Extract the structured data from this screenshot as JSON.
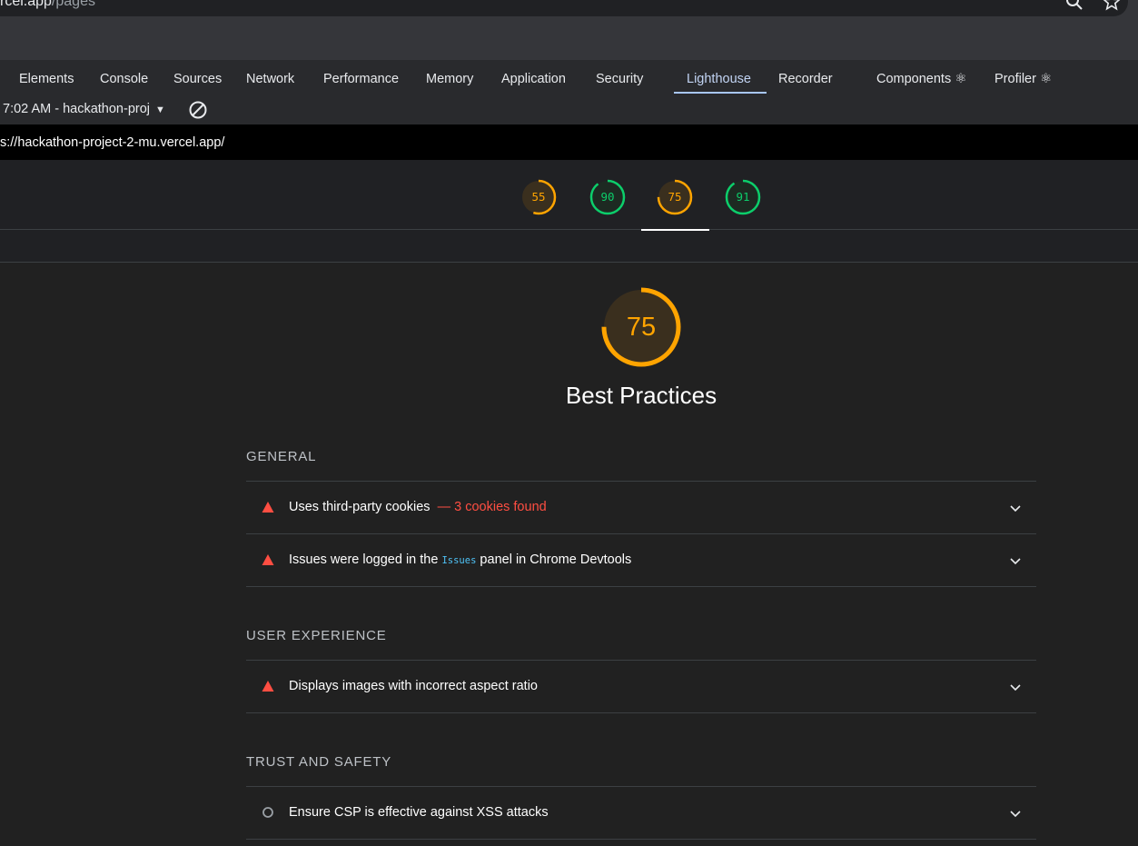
{
  "browser": {
    "url_host": "rcel.app",
    "url_path": "/pages"
  },
  "devtools": {
    "tabs": [
      {
        "label": "Elements"
      },
      {
        "label": "Console"
      },
      {
        "label": "Sources"
      },
      {
        "label": "Network"
      },
      {
        "label": "Performance"
      },
      {
        "label": "Memory"
      },
      {
        "label": "Application"
      },
      {
        "label": "Security"
      },
      {
        "label": "Lighthouse",
        "active": true
      },
      {
        "label": "Recorder"
      },
      {
        "label": "Components ⚛"
      },
      {
        "label": "Profiler ⚛"
      }
    ]
  },
  "lighthouse": {
    "report_select": "7:02 AM - hackathon-proj",
    "report_url": "s://hackathon-project-2-mu.vercel.app/",
    "gauges": [
      {
        "score": "55",
        "fraction": 0.55,
        "color": "#ffa400"
      },
      {
        "score": "90",
        "fraction": 0.9,
        "color": "#0cce6b"
      },
      {
        "score": "75",
        "fraction": 0.75,
        "color": "#ffa400",
        "selected": true
      },
      {
        "score": "91",
        "fraction": 0.91,
        "color": "#0cce6b"
      }
    ],
    "category": {
      "score": "75",
      "fraction": 0.75,
      "title": "Best Practices"
    },
    "groups": [
      {
        "title": "GENERAL",
        "audits": [
          {
            "prefix": "Uses third-party cookies",
            "display": "— 3 cookies found",
            "status": "fail"
          },
          {
            "prefix": "Issues were logged in the ",
            "code": "Issues",
            "suffix": " panel in Chrome Devtools",
            "status": "fail"
          }
        ]
      },
      {
        "title": "USER EXPERIENCE",
        "audits": [
          {
            "prefix": "Displays images with incorrect aspect ratio",
            "status": "fail"
          }
        ]
      },
      {
        "title": "TRUST AND SAFETY",
        "audits": [
          {
            "prefix": "Ensure CSP is effective against XSS attacks",
            "status": "informative"
          }
        ]
      }
    ]
  },
  "colors": {
    "fail": "#ff4e42",
    "average": "#ffa400",
    "pass": "#0cce6b",
    "accent": "#a8c7fa"
  },
  "icons": [
    "search-icon",
    "star-icon",
    "clear-icon",
    "fail-triangle-icon",
    "informative-circle-icon",
    "chevron-down-icon"
  ]
}
